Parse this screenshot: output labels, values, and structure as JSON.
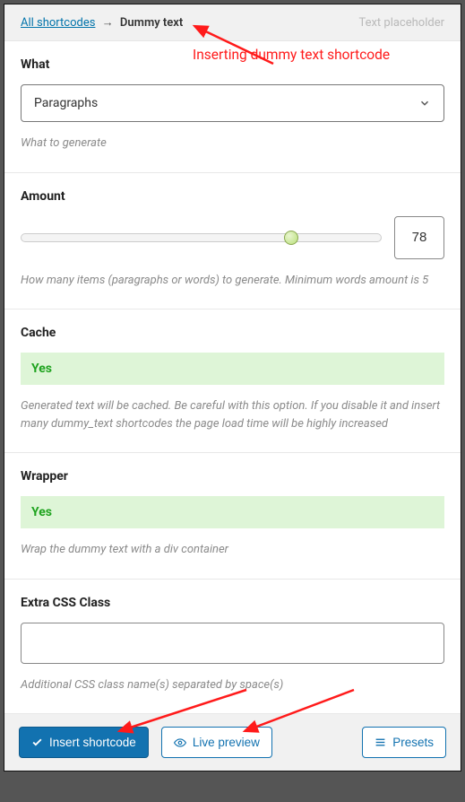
{
  "header": {
    "all_link": "All shortcodes",
    "arrow": "→",
    "current": "Dummy text",
    "placeholder": "Text placeholder"
  },
  "what": {
    "label": "What",
    "value": "Paragraphs",
    "hint": "What to generate"
  },
  "amount": {
    "label": "Amount",
    "value": "78",
    "hint": "How many items (paragraphs or words) to generate. Minimum words amount is 5"
  },
  "cache": {
    "label": "Cache",
    "value": "Yes",
    "hint": "Generated text will be cached. Be careful with this option. If you disable it and insert many dummy_text shortcodes the page load time will be highly increased"
  },
  "wrapper": {
    "label": "Wrapper",
    "value": "Yes",
    "hint": "Wrap the dummy text with a div container"
  },
  "css": {
    "label": "Extra CSS Class",
    "value": "",
    "hint": "Additional CSS class name(s) separated by space(s)"
  },
  "footer": {
    "insert": "Insert shortcode",
    "preview": "Live preview",
    "presets": "Presets"
  },
  "annotation": {
    "text": "Inserting dummy text shortcode"
  }
}
